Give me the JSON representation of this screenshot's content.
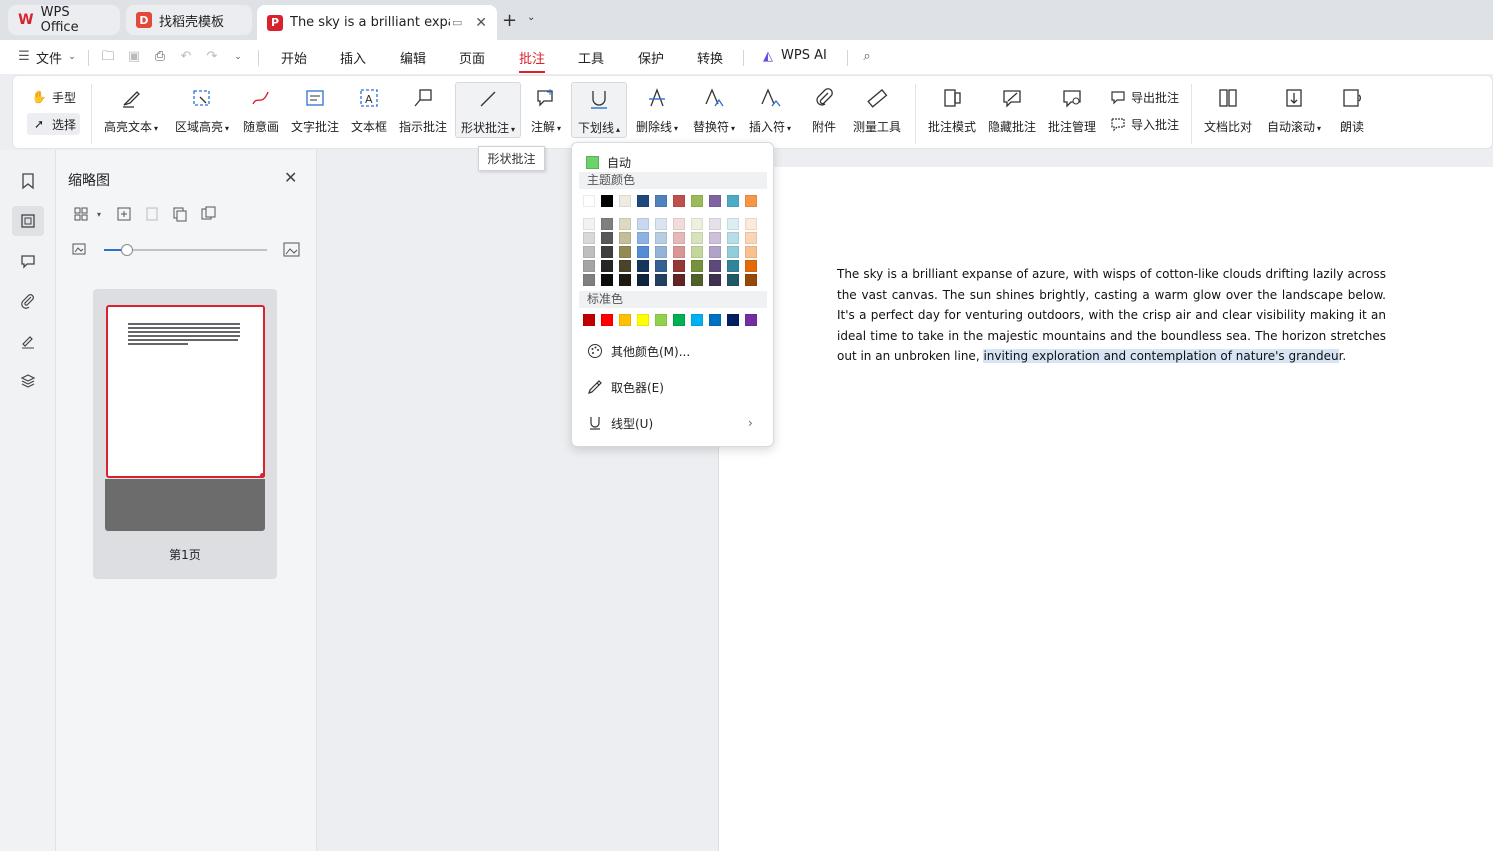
{
  "tabs": [
    {
      "label": "WPS Office",
      "icon": "wps-logo-icon",
      "color": "#d8222e"
    },
    {
      "label": "找稻壳模板",
      "icon": "docer-icon",
      "color": "#e24a3b"
    },
    {
      "label": "The sky is a brilliant expans",
      "icon": "pdf-icon",
      "color": "#d8222e"
    }
  ],
  "menu": {
    "file": "文件",
    "items": [
      "开始",
      "插入",
      "编辑",
      "页面",
      "批注",
      "工具",
      "保护",
      "转换"
    ],
    "active": "批注",
    "ai": "WPS AI"
  },
  "ribbon": {
    "hand": "手型",
    "select": "选择",
    "buttons": [
      "高亮文本",
      "区域高亮",
      "随意画",
      "文字批注",
      "文本框",
      "指示批注",
      "形状批注",
      "注解",
      "下划线",
      "删除线",
      "替换符",
      "插入符",
      "附件",
      "测量工具",
      "批注模式",
      "隐藏批注",
      "批注管理"
    ],
    "export": "导出批注",
    "import": "导入批注",
    "right_buttons": [
      "文档比对",
      "自动滚动",
      "朗读"
    ]
  },
  "tooltip": "形状批注",
  "thumbnail_panel": {
    "title": "缩略图",
    "page_label": "第1页"
  },
  "color_menu": {
    "auto": "自动",
    "theme_label": "主题颜色",
    "standard_label": "标准色",
    "more": "其他颜色(M)...",
    "picker": "取色器(E)",
    "line_type": "线型(U)",
    "theme_top": [
      "#ffffff",
      "#000000",
      "#eeece1",
      "#1f497d",
      "#4f81bd",
      "#c0504d",
      "#9bbb59",
      "#8064a2",
      "#4bacc6",
      "#f79646"
    ],
    "theme_shades": [
      [
        "#f2f2f2",
        "#7f7f7f",
        "#ddd9c3",
        "#c6d9f0",
        "#dbe5f1",
        "#f2dcdb",
        "#ebf1dd",
        "#e5e0ec",
        "#dbeef3",
        "#fdeada"
      ],
      [
        "#d8d8d8",
        "#595959",
        "#c4bd97",
        "#8db3e2",
        "#b8cce4",
        "#e5b9b7",
        "#d7e3bc",
        "#ccc1d9",
        "#b7dde8",
        "#fbd5b5"
      ],
      [
        "#bfbfbf",
        "#3f3f3f",
        "#938953",
        "#548dd4",
        "#95b3d7",
        "#d99694",
        "#c3d69b",
        "#b2a2c7",
        "#92cddc",
        "#fac08f"
      ],
      [
        "#a5a5a5",
        "#262626",
        "#494429",
        "#17365d",
        "#366092",
        "#953734",
        "#76923c",
        "#5f497a",
        "#31859b",
        "#e36c09"
      ],
      [
        "#7f7f7f",
        "#0c0c0c",
        "#1d1b10",
        "#0f243e",
        "#244061",
        "#632423",
        "#4f6128",
        "#3f3151",
        "#205867",
        "#974806"
      ]
    ],
    "standard": [
      "#c00000",
      "#ff0000",
      "#ffc000",
      "#ffff00",
      "#92d050",
      "#00b050",
      "#00b0f0",
      "#0070c0",
      "#002060",
      "#7030a0"
    ]
  },
  "document": {
    "text_main": "The sky is a brilliant expanse of azure, with wisps of cotton-like clouds drifting lazily across the vast canvas. The sun shines brightly, casting a warm glow over the landscape below. It's a perfect day for venturing outdoors, with the crisp air and clear visibility making it an ideal time to take in the majestic mountains and the boundless sea. The horizon stretches out in an unbroken line,",
    "text_highlight": "inviting exploration and contemplation of nature's grandeu",
    "text_end": "r."
  },
  "colors": {
    "accent": "#d8222e",
    "highlight": "#d6e4f5"
  }
}
